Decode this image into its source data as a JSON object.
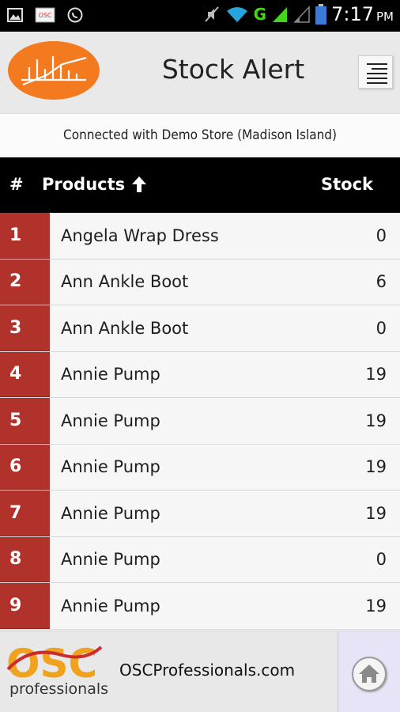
{
  "status_bar": {
    "time": "7:17",
    "ampm": "PM",
    "network": "G",
    "icons": [
      "image-icon",
      "osc-notification-icon",
      "whatsapp-icon",
      "mute-icon",
      "wifi-icon",
      "signal-icon",
      "signal-icon-2",
      "battery-icon"
    ]
  },
  "header": {
    "title": "Stock Alert",
    "menu_icon": "menu-icon"
  },
  "connection": {
    "text": "Connected with Demo Store (Madison Island)"
  },
  "table": {
    "columns": {
      "num": "#",
      "product": "Products",
      "stock": "Stock"
    },
    "sort_icon": "arrow-up-icon",
    "rows": [
      {
        "num": "1",
        "name": "Angela Wrap Dress",
        "stock": "0"
      },
      {
        "num": "2",
        "name": "Ann Ankle Boot",
        "stock": "6"
      },
      {
        "num": "3",
        "name": "Ann Ankle Boot",
        "stock": "0"
      },
      {
        "num": "4",
        "name": "Annie Pump",
        "stock": "19"
      },
      {
        "num": "5",
        "name": "Annie Pump",
        "stock": "19"
      },
      {
        "num": "6",
        "name": "Annie Pump",
        "stock": "19"
      },
      {
        "num": "7",
        "name": "Annie Pump",
        "stock": "19"
      },
      {
        "num": "8",
        "name": "Annie Pump",
        "stock": "0"
      },
      {
        "num": "9",
        "name": "Annie Pump",
        "stock": "19"
      }
    ]
  },
  "footer": {
    "logo_text": "OSC",
    "logo_sub": "professionals",
    "site": "OSCProfessionals.com",
    "home_icon": "home-icon"
  },
  "colors": {
    "accent_red": "#b1312b",
    "logo_orange": "#f47a20",
    "header_bg": "#e9e9e9",
    "table_head_bg": "#000000"
  }
}
